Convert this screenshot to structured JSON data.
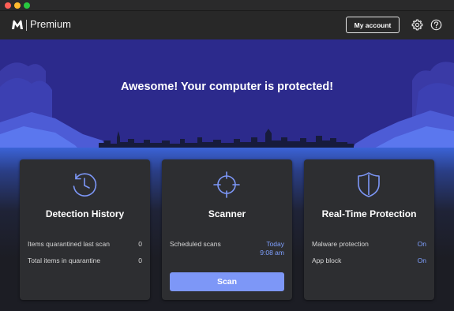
{
  "app": {
    "brand": "Premium",
    "logo_icon": "malwarebytes-logo-icon"
  },
  "header": {
    "my_account_label": "My account",
    "settings_icon": "gear-icon",
    "help_icon": "help-icon"
  },
  "hero": {
    "title": "Awesome! Your computer is protected!"
  },
  "cards": {
    "detection": {
      "icon": "history-clock-icon",
      "title": "Detection History",
      "rows": [
        {
          "label": "Items quarantined last scan",
          "value": "0"
        },
        {
          "label": "Total items in quarantine",
          "value": "0"
        }
      ]
    },
    "scanner": {
      "icon": "crosshair-icon",
      "title": "Scanner",
      "scheduled_label": "Scheduled scans",
      "scheduled_day": "Today",
      "scheduled_time": "9:08 am",
      "scan_button": "Scan"
    },
    "realtime": {
      "icon": "shield-icon",
      "title": "Real-Time Protection",
      "rows": [
        {
          "label": "Malware protection",
          "value": "On"
        },
        {
          "label": "App block",
          "value": "On"
        }
      ]
    }
  },
  "colors": {
    "accent": "#7d97f7",
    "accent_text": "#7fa0ff",
    "hero_bg": "#2c2a8c",
    "card_bg": "#2d2e31"
  }
}
